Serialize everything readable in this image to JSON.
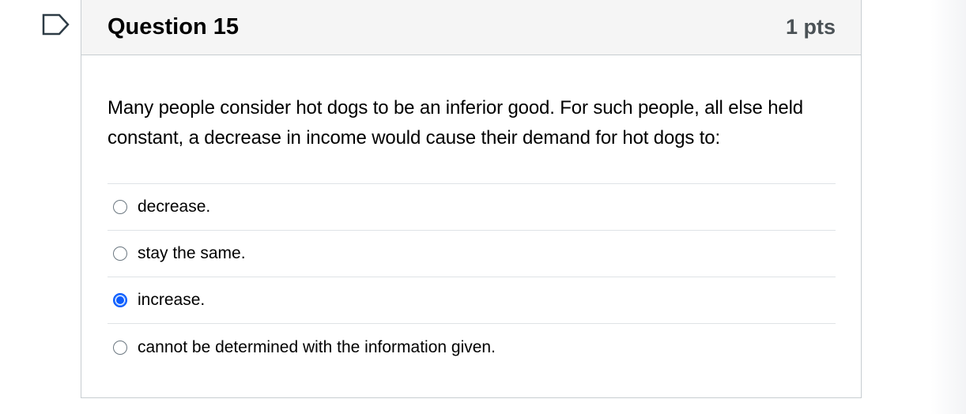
{
  "question": {
    "title": "Question 15",
    "points": "1 pts",
    "text": "Many people consider hot dogs to be an inferior good. For such people, all else held constant, a decrease in income would cause their demand for hot dogs to:",
    "selected_index": 2,
    "options": [
      {
        "label": "decrease."
      },
      {
        "label": "stay the same."
      },
      {
        "label": "increase."
      },
      {
        "label": "cannot be determined with the information given."
      }
    ]
  },
  "icons": {
    "flag": "flag-question-icon"
  },
  "colors": {
    "header_background": "#f5f5f5",
    "border": "#c7cdd1",
    "selected_radio": "#0b5cff"
  }
}
